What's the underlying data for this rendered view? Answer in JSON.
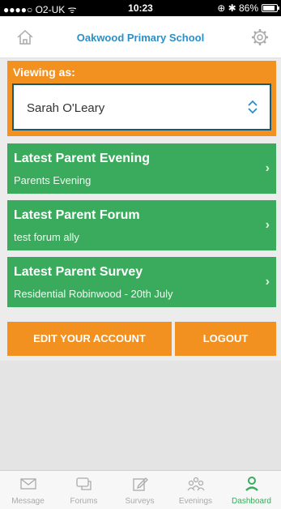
{
  "status": {
    "carrier": "●●●●○ O2-UK ᯤ",
    "time": "10:23",
    "indicators": "⊕ ✱ 86%",
    "battery_level": 0.86
  },
  "header": {
    "title": "Oakwood Primary School",
    "left_icon": "home-icon",
    "right_icon": "gear-icon"
  },
  "viewing": {
    "label": "Viewing as:",
    "selected": "Sarah O'Leary"
  },
  "cards": [
    {
      "title": "Latest Parent Evening",
      "subtitle": "Parents Evening"
    },
    {
      "title": "Latest Parent Forum",
      "subtitle": "test forum ally"
    },
    {
      "title": "Latest Parent Survey",
      "subtitle": "Residential Robinwood - 20th July"
    }
  ],
  "actions": {
    "edit": "EDIT YOUR ACCOUNT",
    "logout": "LOGOUT"
  },
  "tabs": [
    {
      "label": "Message",
      "icon": "envelope-icon"
    },
    {
      "label": "Forums",
      "icon": "chat-icon"
    },
    {
      "label": "Surveys",
      "icon": "edit-icon"
    },
    {
      "label": "Evenings",
      "icon": "group-icon"
    },
    {
      "label": "Dashboard",
      "icon": "person-icon",
      "active": true
    }
  ],
  "colors": {
    "orange": "#f39120",
    "green": "#3aab5c",
    "blue": "#2b8fc9",
    "navy": "#145b76"
  }
}
